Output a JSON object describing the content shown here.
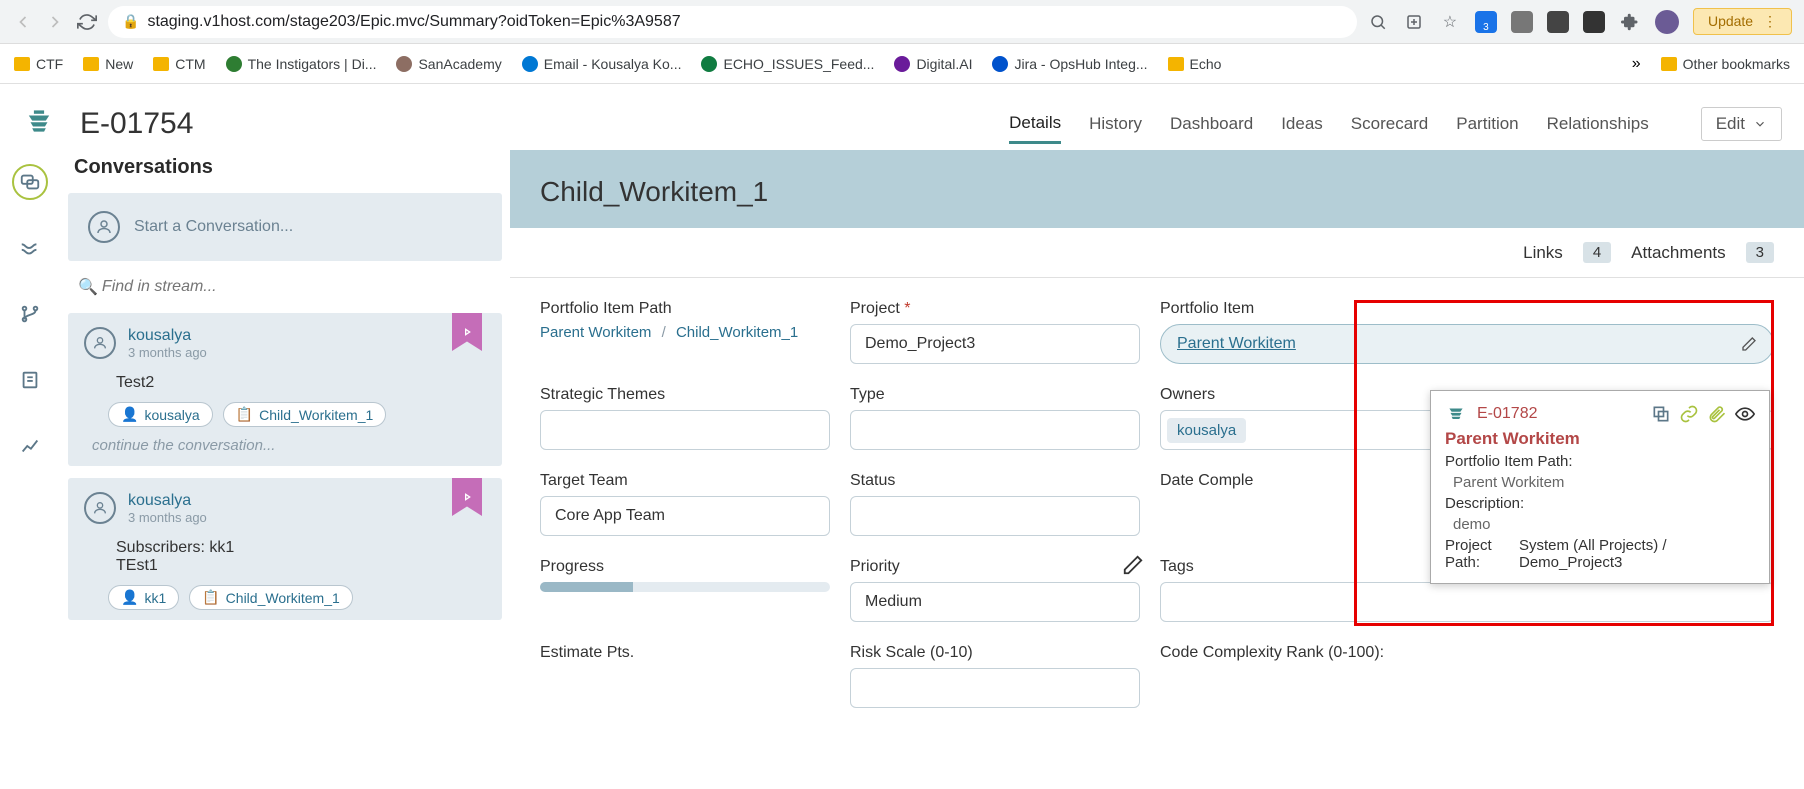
{
  "browser": {
    "url": "staging.v1host.com/stage203/Epic.mvc/Summary?oidToken=Epic%3A9587",
    "update_label": "Update"
  },
  "bookmarks": {
    "items": [
      "CTF",
      "New",
      "CTM",
      "The Instigators | Di...",
      "SanAcademy",
      "Email - Kousalya Ko...",
      "ECHO_ISSUES_Feed...",
      "Digital.AI",
      "Jira - OpsHub Integ...",
      "Echo"
    ],
    "overflow": "»",
    "other": "Other bookmarks"
  },
  "header": {
    "epic_id": "E-01754",
    "tabs": [
      "Details",
      "History",
      "Dashboard",
      "Ideas",
      "Scorecard",
      "Partition",
      "Relationships"
    ],
    "active_tab_index": 0,
    "edit_label": "Edit"
  },
  "conversations": {
    "title": "Conversations",
    "start_placeholder": "Start a Conversation...",
    "find_placeholder": "Find in stream...",
    "continue_placeholder": "continue the conversation...",
    "items": [
      {
        "author": "kousalya",
        "time": "3 months ago",
        "body": "Test2",
        "tags": [
          "kousalya",
          "Child_Workitem_1"
        ]
      },
      {
        "author": "kousalya",
        "time": "3 months ago",
        "body_lines": [
          "Subscribers: kk1",
          "TEst1"
        ],
        "tags": [
          "kk1",
          "Child_Workitem_1"
        ]
      }
    ]
  },
  "detail": {
    "title": "Child_Workitem_1",
    "subtabs": {
      "links_label": "Links",
      "links_count": "4",
      "attachments_label": "Attachments",
      "attachments_count": "3"
    },
    "fields": {
      "portfolio_path_label": "Portfolio Item Path",
      "portfolio_path_crumbs": [
        "Parent Workitem",
        "Child_Workitem_1"
      ],
      "project_label": "Project",
      "project_value": "Demo_Project3",
      "portfolio_item_label": "Portfolio Item",
      "portfolio_item_value": "Parent Workitem",
      "strategic_label": "Strategic Themes",
      "type_label": "Type",
      "owners_label": "Owners",
      "owners_value": "kousalya",
      "target_team_label": "Target Team",
      "target_team_value": "Core App Team",
      "status_label": "Status",
      "date_complete_label": "Date Comple",
      "progress_label": "Progress",
      "progress_pct": 32,
      "priority_label": "Priority",
      "priority_value": "Medium",
      "tags_label": "Tags",
      "estimate_label": "Estimate Pts.",
      "risk_label": "Risk Scale (0-10)",
      "code_complexity_label": "Code Complexity Rank (0-100):"
    },
    "tooltip": {
      "id": "E-01782",
      "title": "Parent Workitem",
      "path_label": "Portfolio Item Path:",
      "path_value": "Parent Workitem",
      "desc_label": "Description:",
      "desc_value": "demo",
      "proj_label": "Project Path:",
      "proj_value_1": "System (All Projects)  /",
      "proj_value_2": "Demo_Project3"
    }
  }
}
